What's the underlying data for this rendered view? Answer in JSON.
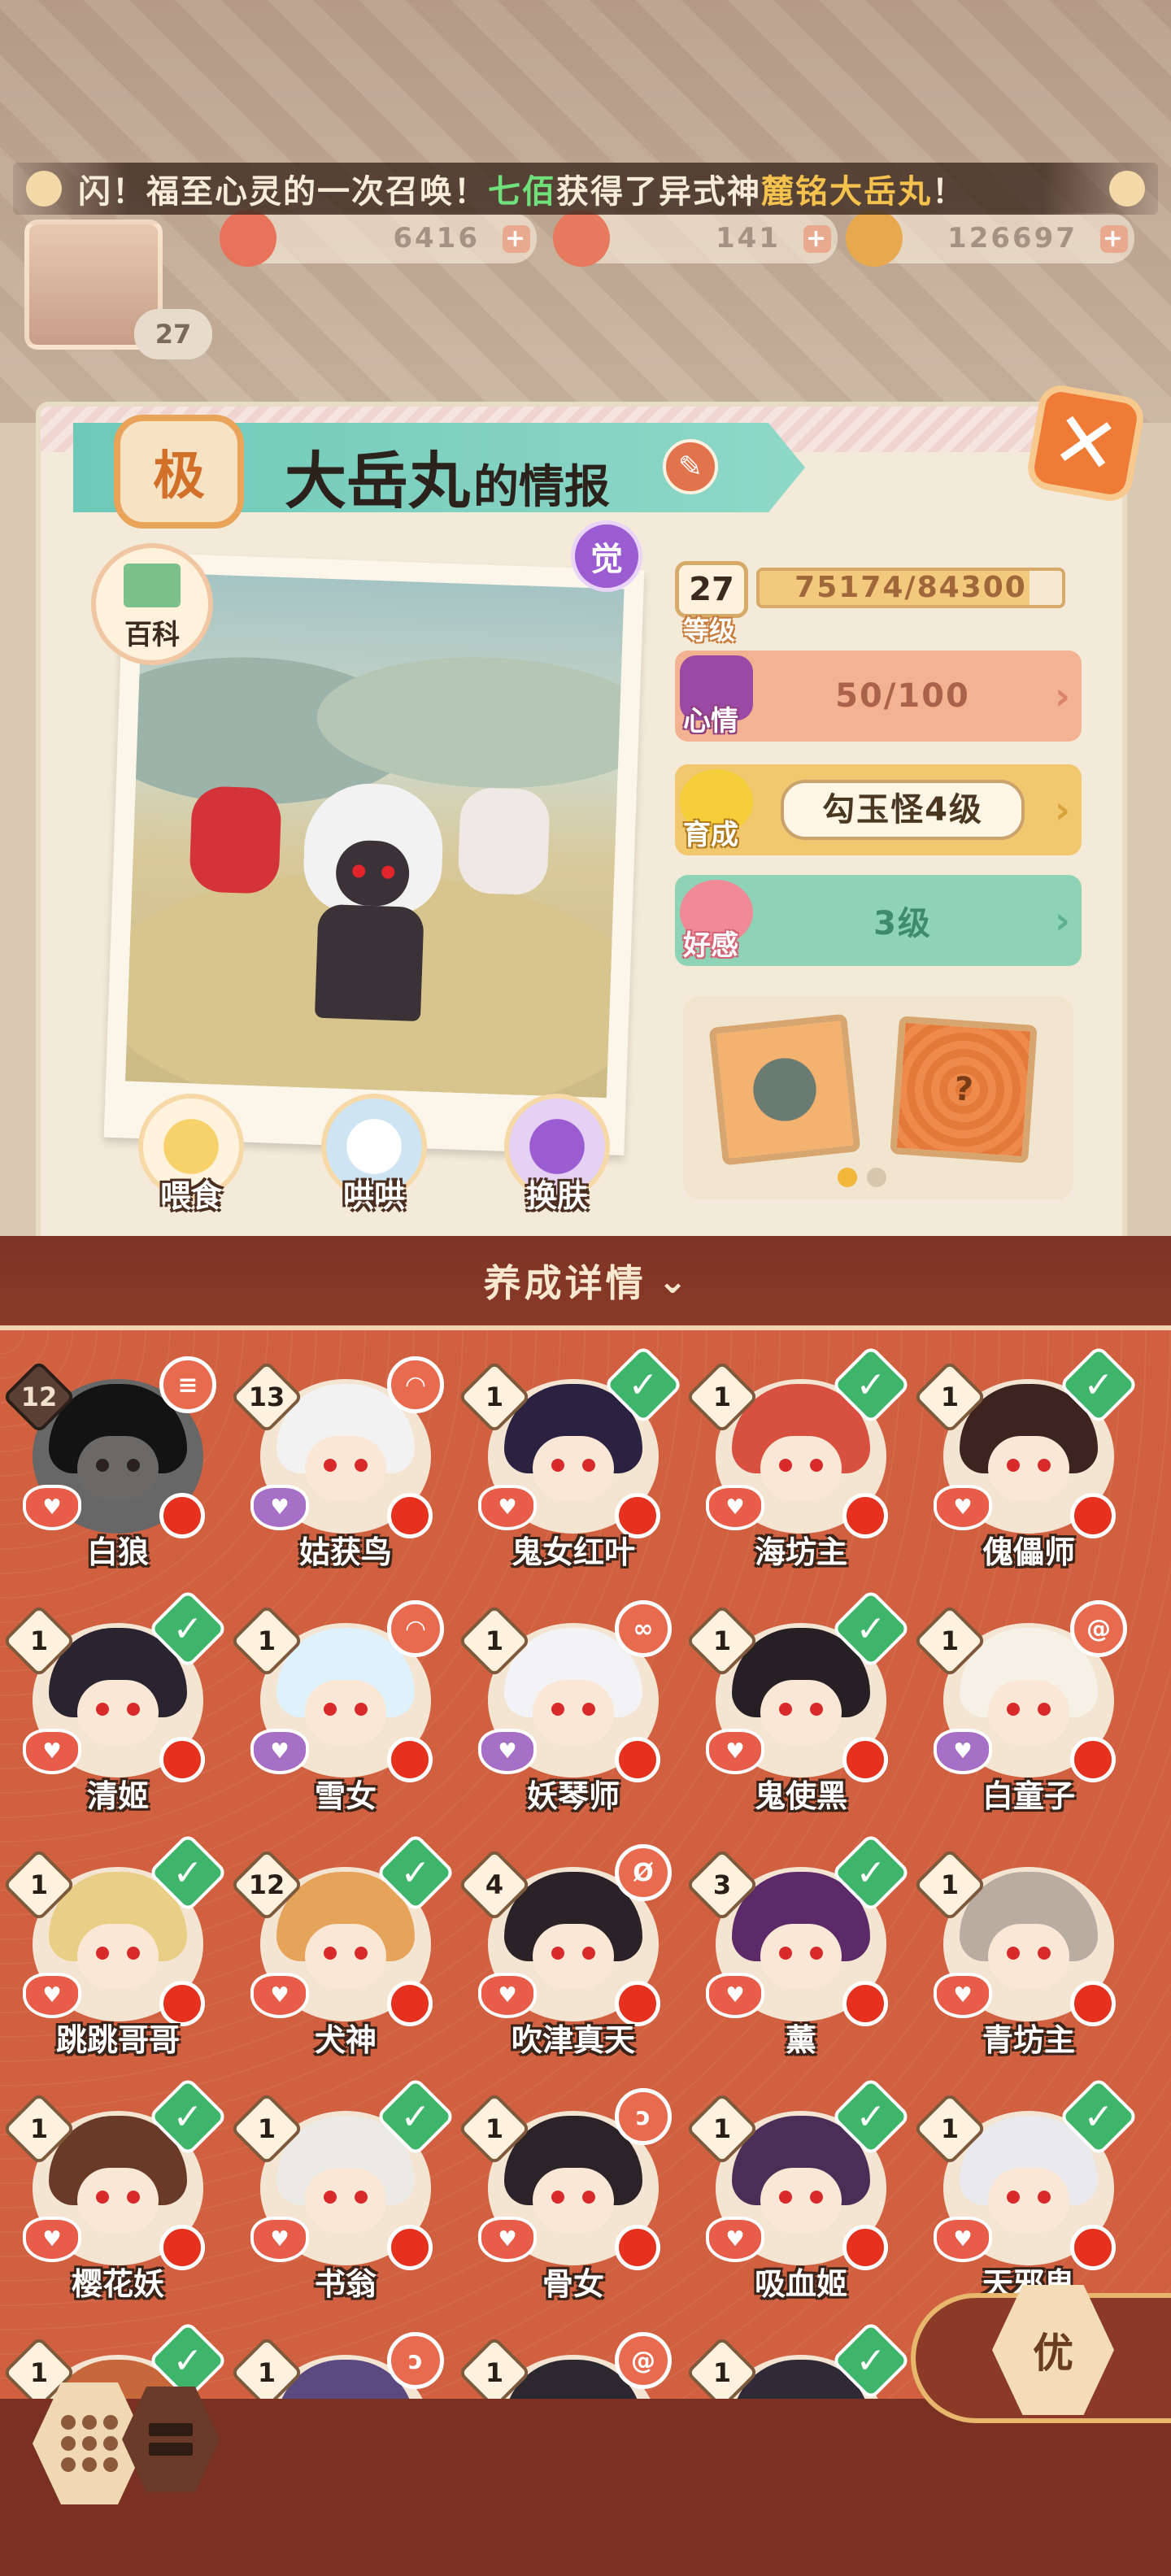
{
  "marquee": {
    "prefix": "闪！福至心灵的一次召唤！",
    "player": "七佰",
    "middle": "获得了异式神",
    "shikigami": "麓铭大岳丸",
    "suffix": "！"
  },
  "resources": {
    "gold": "6416",
    "jade": "141",
    "coins": "126697"
  },
  "player": {
    "level": "27"
  },
  "info": {
    "grade": "极",
    "name": "大岳丸",
    "name_suffix": "的情报",
    "awaken_badge": "觉",
    "encyclopedia_label": "百科",
    "level": "27",
    "level_label": "等级",
    "exp_text": "75174/84300",
    "exp_progress": 0.892,
    "mood_label": "心情",
    "mood_value": "50/100",
    "growth_label": "育成",
    "growth_value": "勾玉怪4级",
    "affection_label": "好感",
    "affection_value": "3级",
    "actions": {
      "feed": "喂食",
      "pet": "哄哄",
      "skin": "换肤"
    },
    "gift_unknown": "?",
    "gift_page": {
      "current": 1,
      "total": 2
    }
  },
  "detail": {
    "title": "养成详情",
    "chevron": "»"
  },
  "shikigami_list": [
    {
      "name": "白狼",
      "level": "12",
      "status": "mark",
      "mark_icon": "scroll-icon",
      "hair": "#2e2a2a",
      "heart": "#e85d4a",
      "dim": true
    },
    {
      "name": "姑获鸟",
      "level": "13",
      "status": "mark",
      "mark_icon": "bell-icon",
      "hair": "#f2f2f2",
      "heart": "#a770c7",
      "dim": false
    },
    {
      "name": "鬼女红叶",
      "level": "1",
      "status": "check",
      "hair": "#2a2240",
      "heart": "#e85d4a",
      "dim": false
    },
    {
      "name": "海坊主",
      "level": "1",
      "status": "check",
      "hair": "#d8503f",
      "heart": "#e85d4a",
      "dim": false
    },
    {
      "name": "傀儡师",
      "level": "1",
      "status": "check",
      "hair": "#3e2420",
      "heart": "#e85d4a",
      "dim": false
    },
    {
      "name": "清姬",
      "level": "1",
      "status": "check",
      "hair": "#2a2430",
      "heart": "#e85d4a",
      "dim": false
    },
    {
      "name": "雪女",
      "level": "1",
      "status": "mark",
      "mark_icon": "bell-icon",
      "hair": "#dff2fb",
      "heart": "#a770c7",
      "dim": false
    },
    {
      "name": "妖琴师",
      "level": "1",
      "status": "mark",
      "mark_icon": "infinity-icon",
      "hair": "#f3f3f5",
      "heart": "#a770c7",
      "dim": false
    },
    {
      "name": "鬼使黑",
      "level": "1",
      "status": "check",
      "hair": "#262024",
      "heart": "#e85d4a",
      "dim": false
    },
    {
      "name": "白童子",
      "level": "1",
      "status": "mark",
      "mark_icon": "swirl-icon",
      "hair": "#f6f1e6",
      "heart": "#a770c7",
      "dim": false
    },
    {
      "name": "跳跳哥哥",
      "level": "1",
      "status": "check",
      "hair": "#e9cf86",
      "heart": "#e85d4a",
      "dim": false
    },
    {
      "name": "犬神",
      "level": "12",
      "status": "check",
      "hair": "#e6a35a",
      "heart": "#e85d4a",
      "dim": false
    },
    {
      "name": "吹津真天",
      "level": "4",
      "status": "mark",
      "mark_icon": "feather-icon",
      "hair": "#2a2226",
      "heart": "#e85d4a",
      "dim": false
    },
    {
      "name": "薰",
      "level": "3",
      "status": "check",
      "hair": "#5c2a68",
      "heart": "#e85d4a",
      "dim": false
    },
    {
      "name": "青坊主",
      "level": "1",
      "status": "none",
      "hair": "#b9aca0",
      "heart": "#e85d4a",
      "dim": false
    },
    {
      "name": "樱花妖",
      "level": "1",
      "status": "check",
      "hair": "#6a3a28",
      "heart": "#e85d4a",
      "dim": false
    },
    {
      "name": "书翁",
      "level": "1",
      "status": "check",
      "hair": "#eceae6",
      "heart": "#e85d4a",
      "dim": false
    },
    {
      "name": "骨女",
      "level": "1",
      "status": "mark",
      "mark_icon": "hook-icon",
      "hair": "#2b2328",
      "heart": "#e85d4a",
      "dim": false
    },
    {
      "name": "吸血姬",
      "level": "1",
      "status": "check",
      "hair": "#4a2e55",
      "heart": "#e85d4a",
      "dim": false
    },
    {
      "name": "天邪鬼",
      "level": "1",
      "status": "check",
      "hair": "#e9e9ee",
      "heart": "#e85d4a",
      "dim": false
    },
    {
      "name": "",
      "level": "1",
      "status": "check",
      "hair": "#c6683a",
      "heart": "#e85d4a",
      "dim": false
    },
    {
      "name": "",
      "level": "1",
      "status": "mark",
      "mark_icon": "hook-icon",
      "hair": "#5b4a80",
      "heart": "#e85d4a",
      "dim": false
    },
    {
      "name": "",
      "level": "1",
      "status": "mark",
      "mark_icon": "swirl-icon",
      "hair": "#2b2830",
      "heart": "#e85d4a",
      "dim": false
    },
    {
      "name": "",
      "level": "1",
      "status": "check",
      "hair": "#302a36",
      "heart": "#e85d4a",
      "dim": false
    }
  ],
  "bottom": {
    "premium_label": "优"
  },
  "colors": {
    "accent_orange": "#ee7b36",
    "list_bg": "#d0603f",
    "check_green": "#3fb56c"
  }
}
